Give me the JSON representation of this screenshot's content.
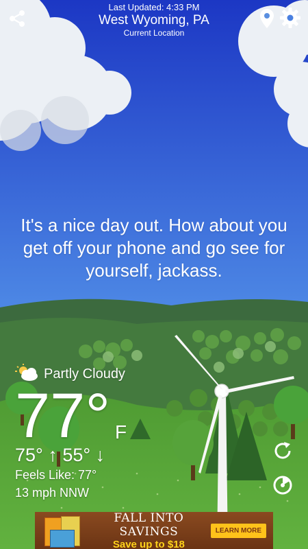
{
  "header": {
    "last_updated": "Last Updated: 4:33 PM",
    "location": "West Wyoming, PA",
    "location_sub": "Current Location"
  },
  "icons": {
    "share": "share-icon",
    "location": "location-pin-icon",
    "settings": "gear-icon",
    "refresh": "refresh-icon",
    "radar": "radar-icon",
    "condition": "partly-cloudy-icon"
  },
  "message": "It's a nice day out. How about you get off your phone and go see for yourself, jackass.",
  "weather": {
    "condition": "Partly Cloudy",
    "temperature": "77°",
    "unit": "F",
    "high_low": "75° ↑ 55° ↓",
    "feels_like": "Feels Like: 77°",
    "wind": "13 mph NNW"
  },
  "ad": {
    "headline": "FALL INTO SAVINGS",
    "subline": "Save up to $18",
    "cta": "LEARN MORE"
  },
  "colors": {
    "sky_top": "#1f3fc8",
    "sky_bottom": "#5b98ea",
    "hills": "#3f7a3c",
    "grass": "#5aa83a",
    "ad_cta": "#ffc21a"
  }
}
